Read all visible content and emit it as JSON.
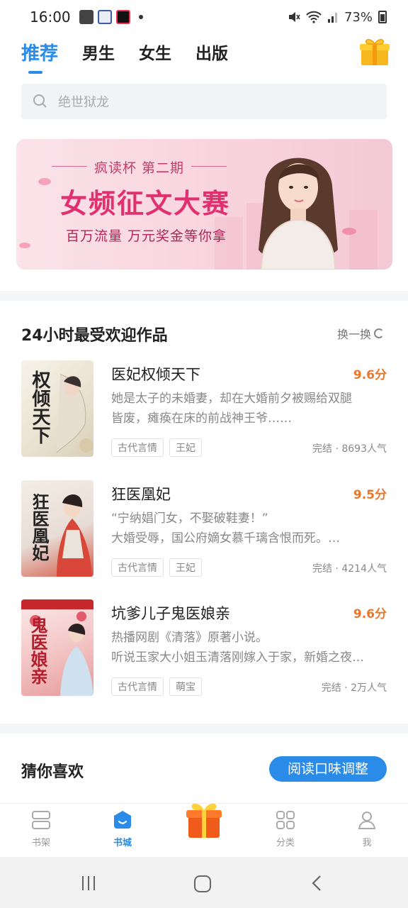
{
  "status_bar": {
    "time": "16:00",
    "battery": "73%"
  },
  "tabs": [
    {
      "label": "推荐",
      "active": true
    },
    {
      "label": "男生",
      "active": false
    },
    {
      "label": "女生",
      "active": false
    },
    {
      "label": "出版",
      "active": false
    }
  ],
  "search": {
    "placeholder": "绝世狱龙"
  },
  "banner": {
    "subtitle": "疯读杯 第二期",
    "title": "女频征文大赛",
    "desc": "百万流量  万元奖金等你拿"
  },
  "section1": {
    "title": "24小时最受欢迎作品",
    "refresh_label": "换一换"
  },
  "books": [
    {
      "title": "医妃权倾天下",
      "score": "9.6分",
      "desc_line1": "她是太子的未婚妻，却在大婚前夕被赐给双腿",
      "desc_line2": "皆废，瘫痪在床的前战神王爷……",
      "tags": [
        "古代言情",
        "王妃"
      ],
      "meta": "完结 · 8693人气",
      "cover_text": "权倾天下"
    },
    {
      "title": "狂医凰妃",
      "score": "9.5分",
      "desc_line1": "“宁纳娼门女，不娶破鞋妻！”",
      "desc_line2": "大婚受辱，国公府嫡女慕千璃含恨而死。…",
      "tags": [
        "古代言情",
        "王妃"
      ],
      "meta": "完结 · 4214人气",
      "cover_text": "狂医凰妃"
    },
    {
      "title": "坑爹儿子鬼医娘亲",
      "score": "9.6分",
      "desc_line1": "热播网剧《清落》原著小说。",
      "desc_line2": "听说玉家大小姐玉清落刚嫁入于家，新婚之夜…",
      "tags": [
        "古代言情",
        "萌宝"
      ],
      "meta": "完结 · 2万人气",
      "cover_text": "鬼医娘亲"
    }
  ],
  "section2": {
    "title": "猜你喜欢",
    "adjust_label": "阅读口味调整"
  },
  "bottom_nav": [
    {
      "label": "书架",
      "icon": "bookshelf-icon",
      "active": false
    },
    {
      "label": "书城",
      "icon": "bookstore-icon",
      "active": true
    },
    {
      "label": "分类",
      "icon": "category-icon",
      "active": false
    },
    {
      "label": "我",
      "icon": "profile-icon",
      "active": false
    }
  ],
  "colors": {
    "accent": "#2a8ce8",
    "score": "#e8772b",
    "banner_title": "#e0306f"
  }
}
